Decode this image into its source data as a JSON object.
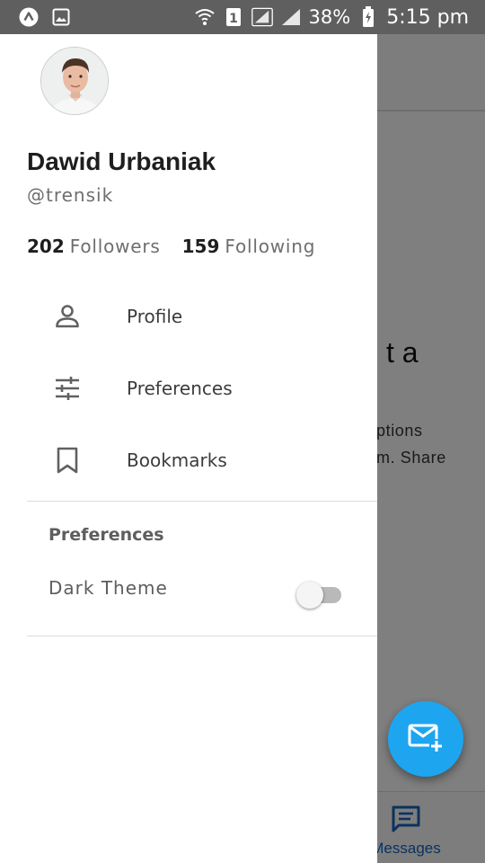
{
  "status_bar": {
    "battery": "38%",
    "time": "5:15 pm",
    "sim_slot": "1",
    "left_icons": [
      "android-notification-icon",
      "image-notification-icon"
    ],
    "right_icons": [
      "wifi-icon",
      "sim-1-icon",
      "signal-icon",
      "signal-icon",
      "battery-charging-icon"
    ]
  },
  "background": {
    "heading_fragment": "t a",
    "body_lines": [
      "ptions",
      "m. Share"
    ],
    "bottom_nav": {
      "label": "Messages",
      "icon": "message-icon",
      "color": "#1565c0"
    },
    "fab": {
      "icon": "compose-mail-icon",
      "color": "#1ea5f0"
    }
  },
  "drawer": {
    "avatar": "user-avatar",
    "name": "Dawid Urbaniak",
    "handle": "@trensik",
    "followers_count": "202",
    "followers_label": "Followers",
    "following_count": "159",
    "following_label": "Following",
    "menu": [
      {
        "label": "Profile",
        "icon": "person-icon"
      },
      {
        "label": "Preferences",
        "icon": "tune-icon"
      },
      {
        "label": "Bookmarks",
        "icon": "bookmark-icon"
      }
    ],
    "section_title": "Preferences",
    "dark_theme_label": "Dark Theme",
    "dark_theme_on": false
  }
}
